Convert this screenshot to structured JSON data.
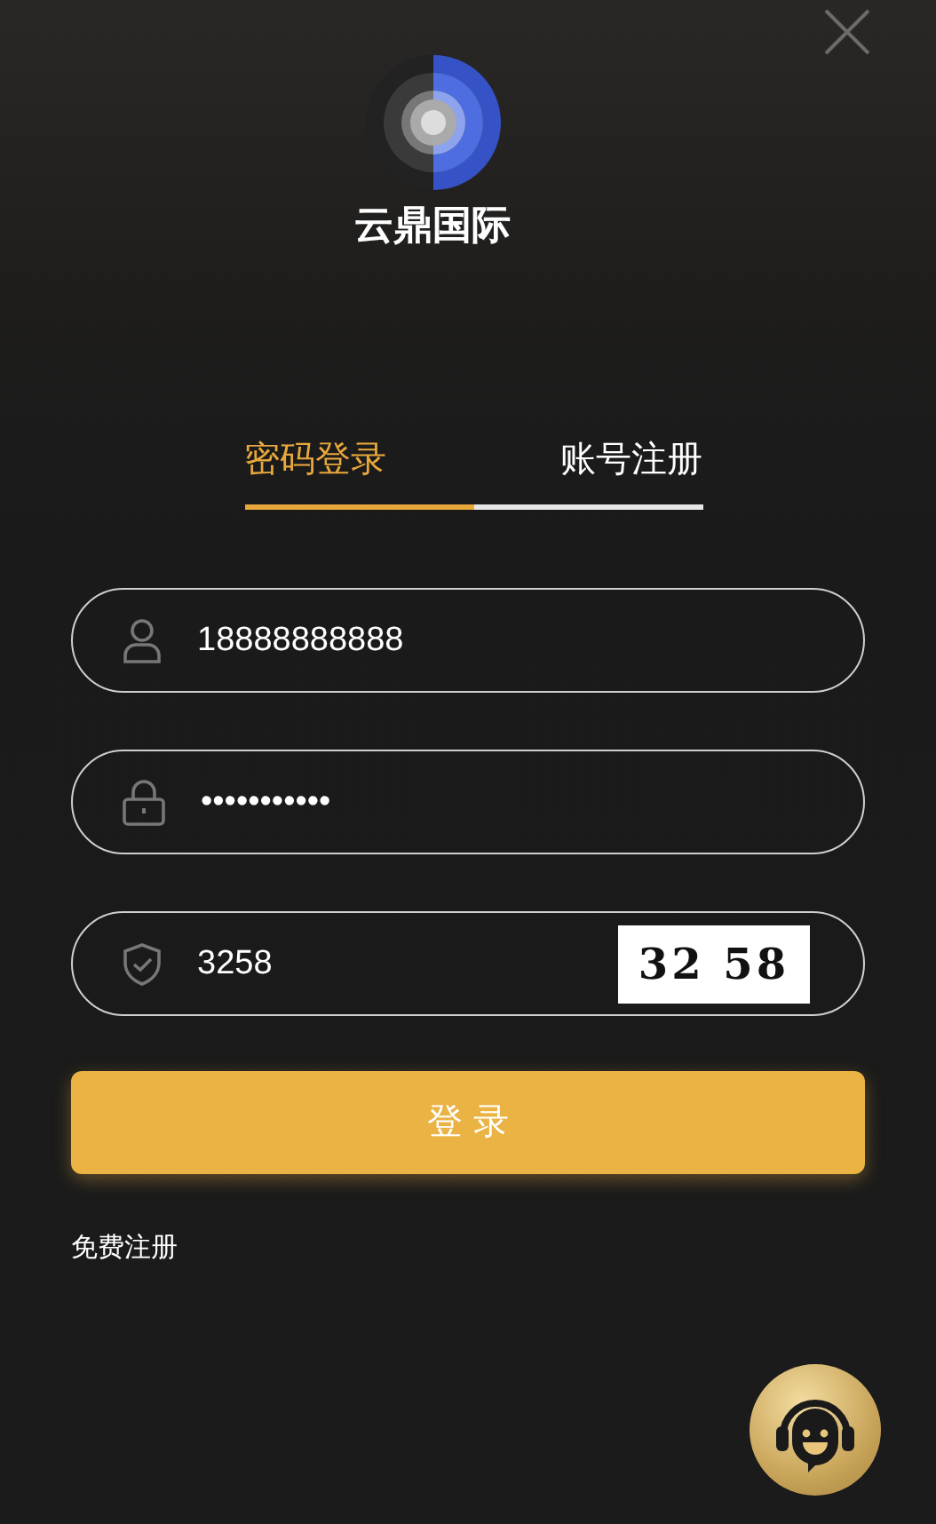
{
  "brand": {
    "name": "云鼎国际"
  },
  "tabs": [
    {
      "label": "密码登录",
      "selected": true
    },
    {
      "label": "账号注册",
      "selected": false
    }
  ],
  "fields": [
    {
      "kind": "user",
      "value": "18888888888"
    },
    {
      "kind": "lock",
      "value": "•••••••••••"
    },
    {
      "kind": "code",
      "value": "3258",
      "captcha_text": "32 58"
    }
  ],
  "login_button": "登 录",
  "register_link": "免费注册"
}
